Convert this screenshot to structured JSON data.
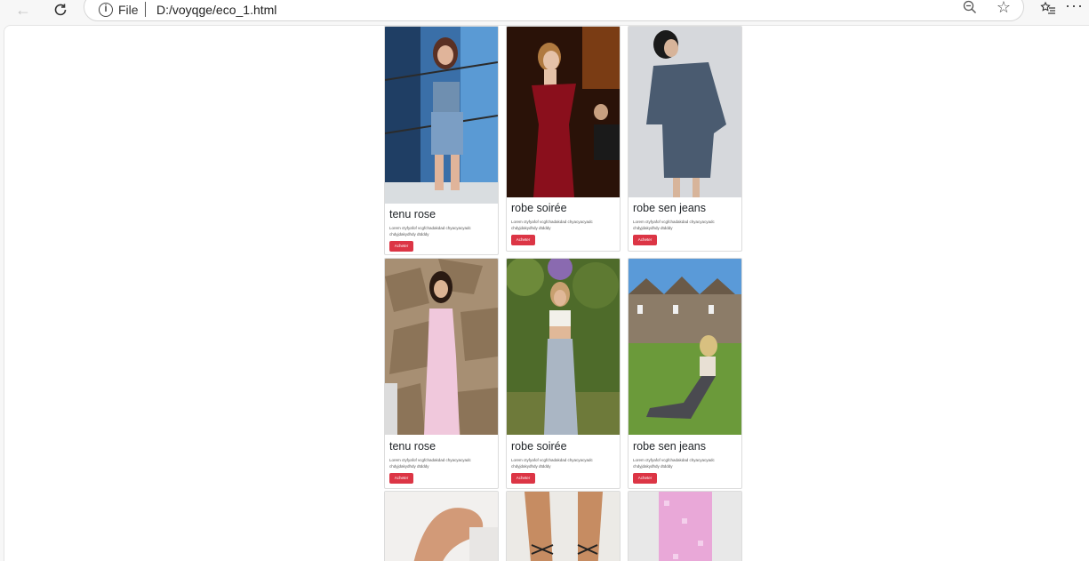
{
  "browser": {
    "scheme_label": "File",
    "url": "D:/voyqge/eco_1.html",
    "icons": [
      "back-arrow-icon",
      "reload-icon",
      "info-icon",
      "zoom-out-icon",
      "star-icon",
      "favorites-icon",
      "more-icon"
    ]
  },
  "products": [
    {
      "title": "tenu rose",
      "description": "Lorem ctyfyafof vcgfchadakdad chyacyacyadc chdyjdakydhdy dtdddy",
      "button": "Acheter",
      "image": "woman in denim strapless top and denim shorts"
    },
    {
      "title": "robe soirée",
      "description": "Lorem ctyfyafof vcgfchadakdad chyacyacyadc chdyjdakydhdy dtdddy",
      "button": "Acheter",
      "image": "woman in red off-shoulder evening dress"
    },
    {
      "title": "robe sen jeans",
      "description": "Lorem ctyfyafof vcgfchadakdad chyacyacyadc chdyjdakydhdy dtdddy",
      "button": "Acheter",
      "image": "woman in denim shirt dress"
    },
    {
      "title": "tenu rose",
      "description": "Lorem ctyfyafof vcgfchadakdad chyacyacyadc chdyjdakydhdy dtdddy",
      "button": "Acheter",
      "image": "woman in pink lace maxi dress"
    },
    {
      "title": "robe soirée",
      "description": "Lorem ctyfyafof vcgfchadakdad chyacyacyadc chdyjdakydhdy dtdddy",
      "button": "Acheter",
      "image": "woman in white crop top and light jeans"
    },
    {
      "title": "robe sen jeans",
      "description": "Lorem ctyfyafof vcgfchadakdad chyacyacyadc chdyjdakydhdy dtdddy",
      "button": "Acheter",
      "image": "woman sitting on grass in wide jeans"
    }
  ],
  "partial_row": [
    "legs closeup photo",
    "lace-up sandals photo",
    "pink lace fabric photo"
  ],
  "colors": {
    "button": "#dc3545",
    "title": "#212529"
  }
}
